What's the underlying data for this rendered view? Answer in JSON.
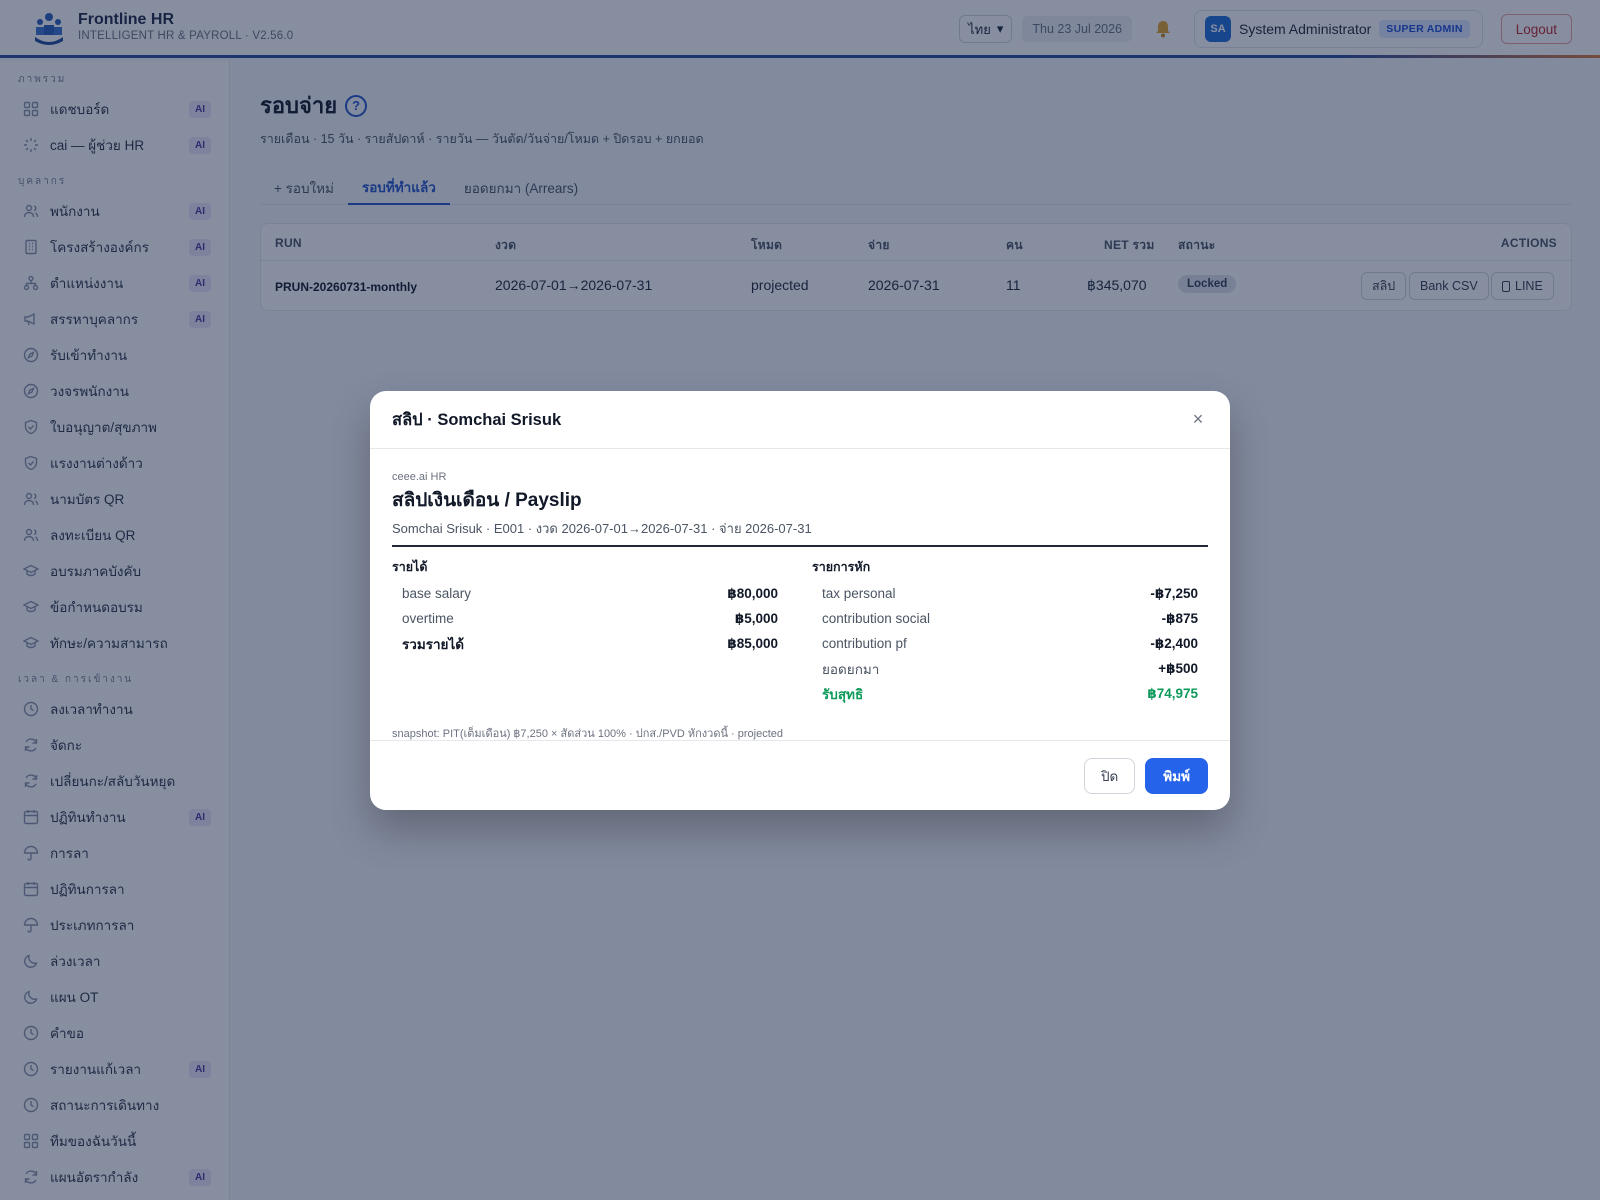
{
  "header": {
    "brand_name": "Frontline HR",
    "brand_sub": "INTELLIGENT HR & PAYROLL · V2.56.0",
    "language": "ไทย",
    "date": "Thu 23 Jul 2026",
    "user_initials": "SA",
    "user_name": "System Administrator",
    "role": "SUPER ADMIN",
    "logout": "Logout"
  },
  "sidebar": {
    "sections": [
      {
        "title": "ภาพรวม",
        "items": [
          {
            "label": "แดชบอร์ด",
            "icon": "grid-icon",
            "ai": "AI"
          },
          {
            "label": "cai — ผู้ช่วย HR",
            "icon": "sparkle-icon",
            "ai": "AI"
          }
        ]
      },
      {
        "title": "บุคลากร",
        "items": [
          {
            "label": "พนักงาน",
            "icon": "users-icon",
            "ai": "AI"
          },
          {
            "label": "โครงสร้างองค์กร",
            "icon": "building-icon",
            "ai": "AI"
          },
          {
            "label": "ตำแหน่งงาน",
            "icon": "org-icon",
            "ai": "AI"
          },
          {
            "label": "สรรหาบุคลากร",
            "icon": "megaphone-icon",
            "ai": "AI"
          },
          {
            "label": "รับเข้าทำงาน",
            "icon": "compass-icon",
            "ai": ""
          },
          {
            "label": "วงจรพนักงาน",
            "icon": "compass-icon",
            "ai": ""
          },
          {
            "label": "ใบอนุญาต/สุขภาพ",
            "icon": "shield-icon",
            "ai": ""
          },
          {
            "label": "แรงงานต่างด้าว",
            "icon": "shield-icon",
            "ai": ""
          },
          {
            "label": "นามบัตร QR",
            "icon": "users-icon",
            "ai": ""
          },
          {
            "label": "ลงทะเบียน QR",
            "icon": "users-icon",
            "ai": ""
          },
          {
            "label": "อบรมภาคบังคับ",
            "icon": "graduation-icon",
            "ai": ""
          },
          {
            "label": "ข้อกำหนดอบรม",
            "icon": "graduation-icon",
            "ai": ""
          },
          {
            "label": "ทักษะ/ความสามารถ",
            "icon": "graduation-icon",
            "ai": ""
          }
        ]
      },
      {
        "title": "เวลา & การเข้างาน",
        "items": [
          {
            "label": "ลงเวลาทำงาน",
            "icon": "clock-icon",
            "ai": ""
          },
          {
            "label": "จัดกะ",
            "icon": "refresh-icon",
            "ai": ""
          },
          {
            "label": "เปลี่ยนกะ/สลับวันหยุด",
            "icon": "refresh-icon",
            "ai": ""
          },
          {
            "label": "ปฏิทินทำงาน",
            "icon": "calendar-icon",
            "ai": "AI"
          },
          {
            "label": "การลา",
            "icon": "umbrella-icon",
            "ai": ""
          },
          {
            "label": "ปฏิทินการลา",
            "icon": "calendar-icon",
            "ai": ""
          },
          {
            "label": "ประเภทการลา",
            "icon": "umbrella-icon",
            "ai": ""
          },
          {
            "label": "ล่วงเวลา",
            "icon": "moon-icon",
            "ai": ""
          },
          {
            "label": "แผน OT",
            "icon": "moon-icon",
            "ai": ""
          },
          {
            "label": "คำขอ",
            "icon": "clock-icon",
            "ai": ""
          },
          {
            "label": "รายงานแก้เวลา",
            "icon": "clock-icon",
            "ai": "AI"
          },
          {
            "label": "สถานะการเดินทาง",
            "icon": "clock-icon",
            "ai": ""
          },
          {
            "label": "ทีมของฉันวันนี้",
            "icon": "grid-icon",
            "ai": ""
          },
          {
            "label": "แผนอัตรากำลัง",
            "icon": "refresh-icon",
            "ai": "AI"
          }
        ]
      }
    ]
  },
  "page": {
    "title": "รอบจ่าย",
    "help": "?",
    "subtitle": "รายเดือน · 15 วัน · รายสัปดาห์ · รายวัน — วันตัด/วันจ่าย/โหมด + ปิดรอบ + ยกยอด",
    "tabs": [
      "+ รอบใหม่",
      "รอบที่ทำแล้ว",
      "ยอดยกมา (Arrears)"
    ],
    "active_tab": 1,
    "table": {
      "headers": {
        "run": "RUN",
        "period": "งวด",
        "mode": "โหมด",
        "pay": "จ่าย",
        "people": "คน",
        "net": "NET รวม",
        "status": "สถานะ",
        "actions": "ACTIONS"
      },
      "row": {
        "run": "PRUN-20260731-monthly",
        "period": "2026-07-01→2026-07-31",
        "mode": "projected",
        "pay": "2026-07-31",
        "people": "11",
        "net": "฿345,070",
        "status": "Locked",
        "act_slip": "สลิป",
        "act_csv": "Bank CSV",
        "act_line": "LINE"
      }
    }
  },
  "modal": {
    "title": "สลิป · Somchai Srisuk",
    "close": "×",
    "org": "ceee.ai HR",
    "slip_title": "สลิปเงินเดือน / Payslip",
    "meta": "Somchai Srisuk · E001 · งวด 2026-07-01→2026-07-31 · จ่าย 2026-07-31",
    "income_title": "รายได้",
    "income": [
      {
        "k": "base salary",
        "v": "฿80,000"
      },
      {
        "k": "overtime",
        "v": "฿5,000"
      }
    ],
    "income_total": {
      "k": "รวมรายได้",
      "v": "฿85,000"
    },
    "deduct_title": "รายการหัก",
    "deductions": [
      {
        "k": "tax personal",
        "v": "-฿7,250"
      },
      {
        "k": "contribution social",
        "v": "-฿875"
      },
      {
        "k": "contribution pf",
        "v": "-฿2,400"
      },
      {
        "k": "ยอดยกมา",
        "v": "+฿500"
      }
    ],
    "net": {
      "k": "รับสุทธิ",
      "v": "฿74,975"
    },
    "snapshot": "snapshot: PIT(เต็มเดือน) ฿7,250 × สัดส่วน 100% · ปกส./PVD หักงวดนี้ · projected",
    "btn_close": "ปิด",
    "btn_print": "พิมพ์"
  },
  "colors": {
    "accent": "#2563eb",
    "net_green": "#0d9a5a",
    "danger": "#c0262d"
  }
}
